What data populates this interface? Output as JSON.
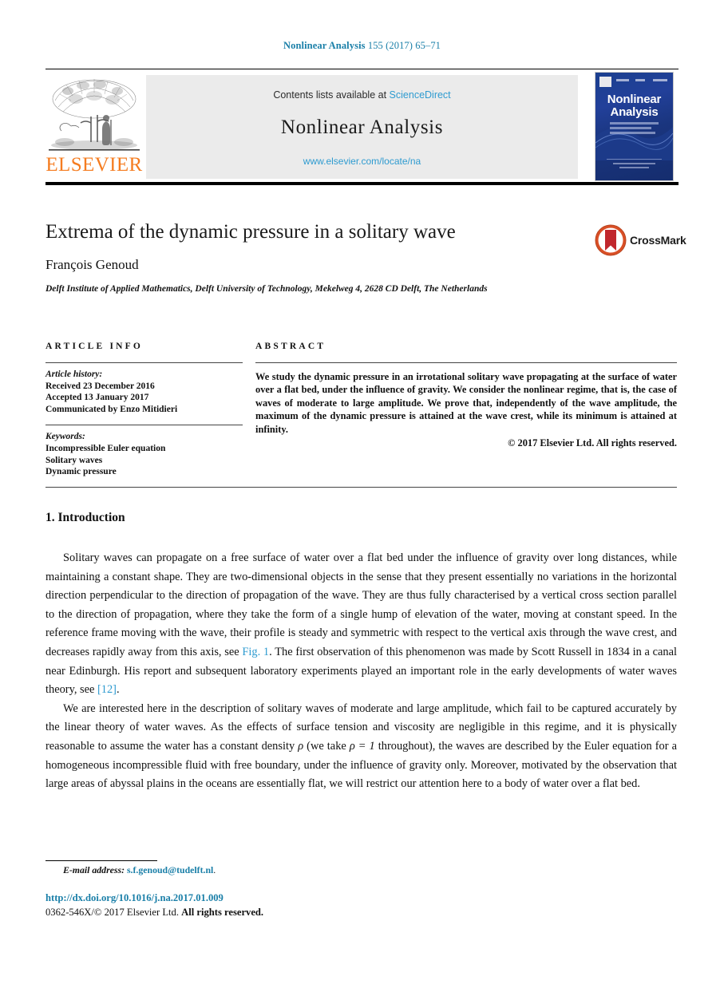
{
  "running_head": {
    "journal": "Nonlinear Analysis",
    "citation": "155 (2017) 65–71"
  },
  "masthead": {
    "publisher_wordmark": "ELSEVIER",
    "contents_prefix": "Contents lists available at",
    "contents_link": "ScienceDirect",
    "journal_title": "Nonlinear Analysis",
    "journal_url": "www.elsevier.com/locate/na",
    "cover_title_line1": "Nonlinear",
    "cover_title_line2": "Analysis"
  },
  "article": {
    "title": "Extrema of the dynamic pressure in a solitary wave",
    "author": "François Genoud",
    "affiliation": "Delft Institute of Applied Mathematics, Delft University of Technology, Mekelweg 4, 2628 CD Delft, The Netherlands",
    "crossmark_label": "CrossMark"
  },
  "info": {
    "label": "ARTICLE INFO",
    "history_heading": "Article history:",
    "history": [
      "Received 23 December 2016",
      "Accepted 13 January 2017",
      "Communicated by Enzo Mitidieri"
    ],
    "keywords_heading": "Keywords:",
    "keywords": [
      "Incompressible Euler equation",
      "Solitary waves",
      "Dynamic pressure"
    ]
  },
  "abstract": {
    "label": "ABSTRACT",
    "text": "We study the dynamic pressure in an irrotational solitary wave propagating at the surface of water over a flat bed, under the influence of gravity. We consider the nonlinear regime, that is, the case of waves of moderate to large amplitude. We prove that, independently of the wave amplitude, the maximum of the dynamic pressure is attained at the wave crest, while its minimum is attained at infinity.",
    "copyright": "© 2017 Elsevier Ltd. All rights reserved."
  },
  "body": {
    "section_heading": "1. Introduction",
    "paragraph1_part1": "Solitary waves can propagate on a free surface of water over a flat bed under the influence of gravity over long distances, while maintaining a constant shape. They are two-dimensional objects in the sense that they present essentially no variations in the horizontal direction perpendicular to the direction of propagation of the wave. They are thus fully characterised by a vertical cross section parallel to the direction of propagation, where they take the form of a single hump of elevation of the water, moving at constant speed. In the reference frame moving with the wave, their profile is steady and symmetric with respect to the vertical axis through the wave crest, and decreases rapidly away from this axis, see ",
    "paragraph1_link1": "Fig. 1",
    "paragraph1_part2": ". The first observation of this phenomenon was made by Scott Russell in 1834 in a canal near Edinburgh. His report and subsequent laboratory experiments played an important role in the early developments of water waves theory, see ",
    "paragraph1_link2": "[12]",
    "paragraph1_part3": ".",
    "paragraph2_part1": "We are interested here in the description of solitary waves of moderate and large amplitude, which fail to be captured accurately by the linear theory of water waves. As the effects of surface tension and viscosity are negligible in this regime, and it is physically reasonable to assume the water has a constant density ",
    "paragraph2_rho1": "ρ",
    "paragraph2_part2": " (we take ",
    "paragraph2_rho2": "ρ = 1",
    "paragraph2_part3": " throughout), the waves are described by the Euler equation for a homogeneous incompressible fluid with free boundary, under the influence of gravity only. Moreover, motivated by the observation that large areas of abyssal plains in the oceans are essentially flat, we will restrict our attention here to a body of water over a flat bed."
  },
  "footer": {
    "email_label": "E-mail address:",
    "email": "s.f.genoud@tudelft.nl",
    "email_period": ".",
    "doi": "http://dx.doi.org/10.1016/j.na.2017.01.009",
    "issn_prefix": "0362-546X/© 2017 Elsevier Ltd.",
    "issn_suffix": "All rights reserved."
  },
  "colors": {
    "link_blue": "#2e9bd0",
    "header_blue": "#1a7fa8",
    "elsevier_orange": "#F57C20",
    "crossmark_red": "#c1272d",
    "banner_gray": "#ebebeb"
  }
}
